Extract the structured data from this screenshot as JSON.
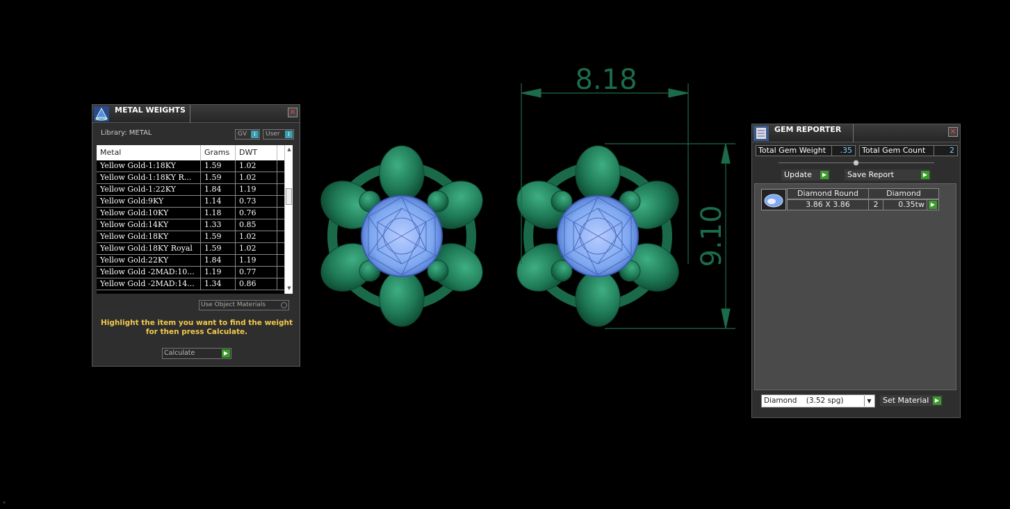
{
  "metal_weights": {
    "title": "METAL WEIGHTS",
    "library_label": "Library: METAL",
    "toggle_gv": "GV",
    "toggle_user": "User",
    "toggle_indicator": "I",
    "columns": [
      "Metal",
      "Grams",
      "DWT"
    ],
    "rows": [
      [
        "Yellow Gold-1:18KY",
        "1.59",
        "1.02"
      ],
      [
        "Yellow Gold-1:18KY R...",
        "1.59",
        "1.02"
      ],
      [
        "Yellow Gold-1:22KY",
        "1.84",
        "1.19"
      ],
      [
        "Yellow Gold:9KY",
        "1.14",
        "0.73"
      ],
      [
        "Yellow Gold:10KY",
        "1.18",
        "0.76"
      ],
      [
        "Yellow Gold:14KY",
        "1.33",
        "0.85"
      ],
      [
        "Yellow Gold:18KY",
        "1.59",
        "1.02"
      ],
      [
        "Yellow Gold:18KY Royal",
        "1.59",
        "1.02"
      ],
      [
        "Yellow Gold:22KY",
        "1.84",
        "1.19"
      ],
      [
        "Yellow Gold -2MAD:10...",
        "1.19",
        "0.77"
      ],
      [
        "Yellow Gold -2MAD:14...",
        "1.34",
        "0.86"
      ]
    ],
    "use_object_materials": "Use Object Materials",
    "hint": "Highlight the item you want to find the weight for then press Calculate.",
    "calculate_label": "Calculate"
  },
  "dimensions": {
    "width": "8.18",
    "height": "9.10"
  },
  "gem_reporter": {
    "title": "GEM REPORTER",
    "total_weight_label": "Total Gem Weight",
    "total_weight_value": ".35",
    "total_count_label": "Total Gem Count",
    "total_count_value": "2",
    "update_label": "Update",
    "save_report_label": "Save Report",
    "gem_name": "Diamond Round",
    "gem_size": "3.86 X 3.86",
    "gem_material": "Diamond",
    "gem_count": "2",
    "gem_weight": "0.35tw",
    "material_select": "Diamond    (3.52 spg)",
    "set_material_label": "Set Material"
  },
  "colors": {
    "metal_green": "#1f7a57",
    "gem_blue": "#7ea8f0",
    "dimension_green": "#1c6b4a",
    "hint_yellow": "#f2c94c"
  }
}
